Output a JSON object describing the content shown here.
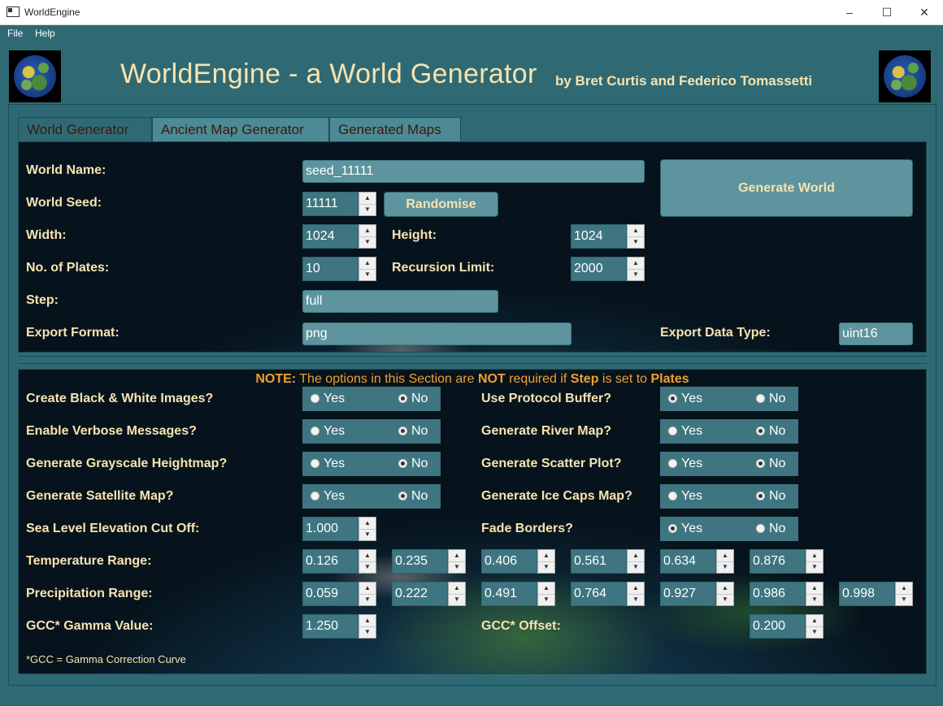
{
  "window": {
    "title": "WorldEngine"
  },
  "menu": [
    "File",
    "Help"
  ],
  "header": {
    "title": "WorldEngine - a World Generator",
    "subtitle": "by Bret Curtis and Federico Tomassetti"
  },
  "tabs": [
    "World Generator",
    "Ancient Map Generator",
    "Generated Maps"
  ],
  "generator": {
    "world_name": {
      "label": "World Name:",
      "value": "seed_11111"
    },
    "world_seed": {
      "label": "World Seed:",
      "value": "11111"
    },
    "randomise_label": "Randomise",
    "generate_label": "Generate World",
    "width": {
      "label": "Width:",
      "value": "1024"
    },
    "height": {
      "label": "Height:",
      "value": "1024"
    },
    "plates": {
      "label": "No. of Plates:",
      "value": "10"
    },
    "recursion": {
      "label": "Recursion Limit:",
      "value": "2000"
    },
    "step": {
      "label": "Step:",
      "value": "full"
    },
    "export_format": {
      "label": "Export Format:",
      "value": "png"
    },
    "export_data_type": {
      "label": "Export Data Type:",
      "value": "uint16"
    }
  },
  "note": {
    "prefix": "NOTE:",
    "part1": " The options in this Section are ",
    "not": "NOT",
    "part2": " required if ",
    "step": "Step",
    "part3": " is set to ",
    "plates": "Plates"
  },
  "options": {
    "yes": "Yes",
    "no": "No",
    "bw_images": {
      "label": "Create Black & White Images?",
      "selected": "No"
    },
    "verbose": {
      "label": "Enable Verbose Messages?",
      "selected": "No"
    },
    "grayscale": {
      "label": "Generate Grayscale Heightmap?",
      "selected": "No"
    },
    "satellite": {
      "label": "Generate Satellite Map?",
      "selected": "No"
    },
    "protobuf": {
      "label": "Use Protocol Buffer?",
      "selected": "Yes"
    },
    "river": {
      "label": "Generate River Map?",
      "selected": "No"
    },
    "scatter": {
      "label": "Generate Scatter Plot?",
      "selected": "No"
    },
    "icecaps": {
      "label": "Generate Ice Caps Map?",
      "selected": "No"
    },
    "fade": {
      "label": "Fade Borders?",
      "selected": "Yes"
    },
    "sea_level": {
      "label": "Sea Level Elevation Cut Off:",
      "value": "1.000"
    },
    "temperature": {
      "label": "Temperature Range:",
      "values": [
        "0.126",
        "0.235",
        "0.406",
        "0.561",
        "0.634",
        "0.876"
      ]
    },
    "precipitation": {
      "label": "Precipitation Range:",
      "values": [
        "0.059",
        "0.222",
        "0.491",
        "0.764",
        "0.927",
        "0.986",
        "0.998"
      ]
    },
    "gamma": {
      "label": "GCC* Gamma Value:",
      "value": "1.250"
    },
    "offset": {
      "label": "GCC* Offset:",
      "value": "0.200"
    },
    "footnote": "*GCC = Gamma Correction Curve"
  }
}
